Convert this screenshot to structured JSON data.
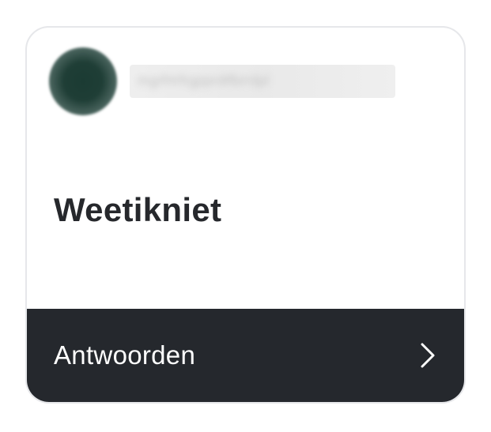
{
  "card": {
    "username_placeholder": "mgrfrtrfrgpprdtfbrrdpl",
    "question": "Weetikniet",
    "action_label": "Antwoorden",
    "action_icon": "chevron-right-icon"
  },
  "colors": {
    "footer_bg": "#25282d",
    "text_dark": "#26282c",
    "border": "#e6e7ea"
  }
}
